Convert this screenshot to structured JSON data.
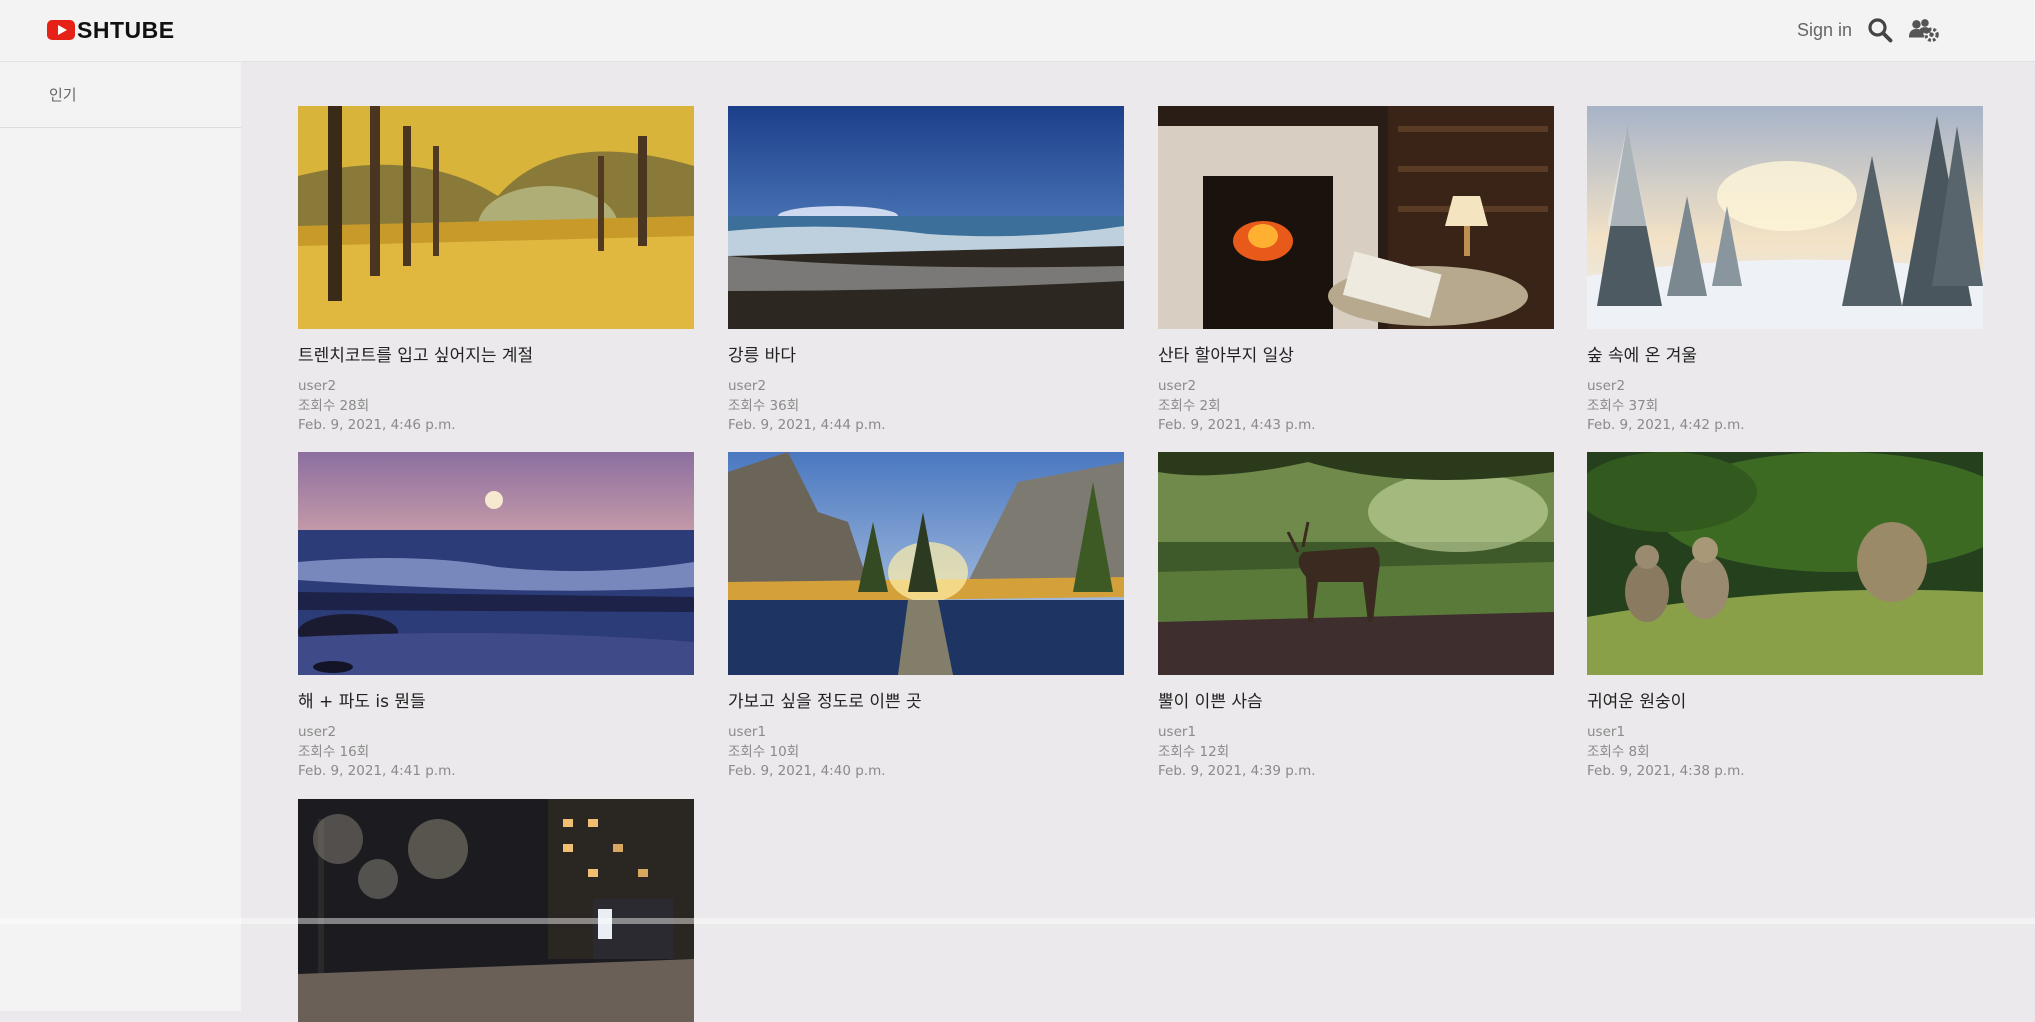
{
  "header": {
    "logo_text": "SHTUBE",
    "signin_label": "Sign in",
    "search_icon": "search-icon",
    "users_icon": "users-gear-icon"
  },
  "sidebar": {
    "items": [
      {
        "label": "인기"
      }
    ]
  },
  "videos": [
    {
      "title": "트렌치코트를 입고 싶어지는 계절",
      "user": "user2",
      "views": "조회수 28회",
      "date": "Feb. 9, 2021, 4:46 p.m.",
      "thumbnail": "autumn-park-path"
    },
    {
      "title": "강릉 바다",
      "user": "user2",
      "views": "조회수 36회",
      "date": "Feb. 9, 2021, 4:44 p.m.",
      "thumbnail": "sea-beach"
    },
    {
      "title": "산타 할아부지 일상",
      "user": "user2",
      "views": "조회수 2회",
      "date": "Feb. 9, 2021, 4:43 p.m.",
      "thumbnail": "fireplace-room"
    },
    {
      "title": "숲 속에 온 겨울",
      "user": "user2",
      "views": "조회수 37회",
      "date": "Feb. 9, 2021, 4:42 p.m.",
      "thumbnail": "snowy-forest"
    },
    {
      "title": "해 + 파도 is 뭔들",
      "user": "user2",
      "views": "조회수 16회",
      "date": "Feb. 9, 2021, 4:41 p.m.",
      "thumbnail": "moon-over-waves"
    },
    {
      "title": "가보고 싶을 정도로 이쁜 곳",
      "user": "user1",
      "views": "조회수 10회",
      "date": "Feb. 9, 2021, 4:40 p.m.",
      "thumbnail": "mountain-lake-sunset"
    },
    {
      "title": "뿔이 이쁜 사슴",
      "user": "user1",
      "views": "조회수 12회",
      "date": "Feb. 9, 2021, 4:39 p.m.",
      "thumbnail": "deer-in-forest"
    },
    {
      "title": "귀여운 원숭이",
      "user": "user1",
      "views": "조회수 8회",
      "date": "Feb. 9, 2021, 4:38 p.m.",
      "thumbnail": "monkeys-on-grass"
    },
    {
      "title": "",
      "user": "",
      "views": "",
      "date": "",
      "thumbnail": "night-city-street"
    }
  ],
  "colors": {
    "brand_red": "#e62117",
    "background": "#ebe9eb",
    "header_bg": "#f3f3f3",
    "meta_text": "#8a8a8a"
  }
}
